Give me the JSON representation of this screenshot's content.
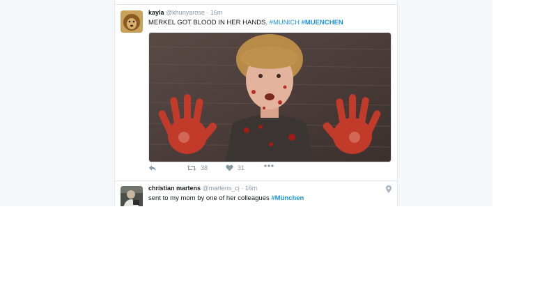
{
  "tweets": [
    {
      "name": "kayla",
      "handle": "@khunyarose",
      "separator": "·",
      "time": "16m",
      "text_plain": " MERKEL GOT BLOOD IN HER HANDS. ",
      "hashtags": [
        "#MUNICH",
        "#MUENCHEN"
      ],
      "retweets": "38",
      "likes": "31"
    },
    {
      "name": "christian martens",
      "handle": "@martens_cj",
      "separator": "·",
      "time": "16m",
      "text_plain": "sent to my mom by one of her colleagues ",
      "hashtags": [
        "#München"
      ]
    }
  ],
  "icons": {
    "reply": "reply-icon",
    "retweet": "retweet-icon",
    "like": "heart-icon",
    "more": "more-icon",
    "location": "location-pin-icon"
  },
  "colors": {
    "hashtag": "#1b95e0",
    "meta": "#8899a6",
    "page_bg": "#f5f8fa"
  }
}
